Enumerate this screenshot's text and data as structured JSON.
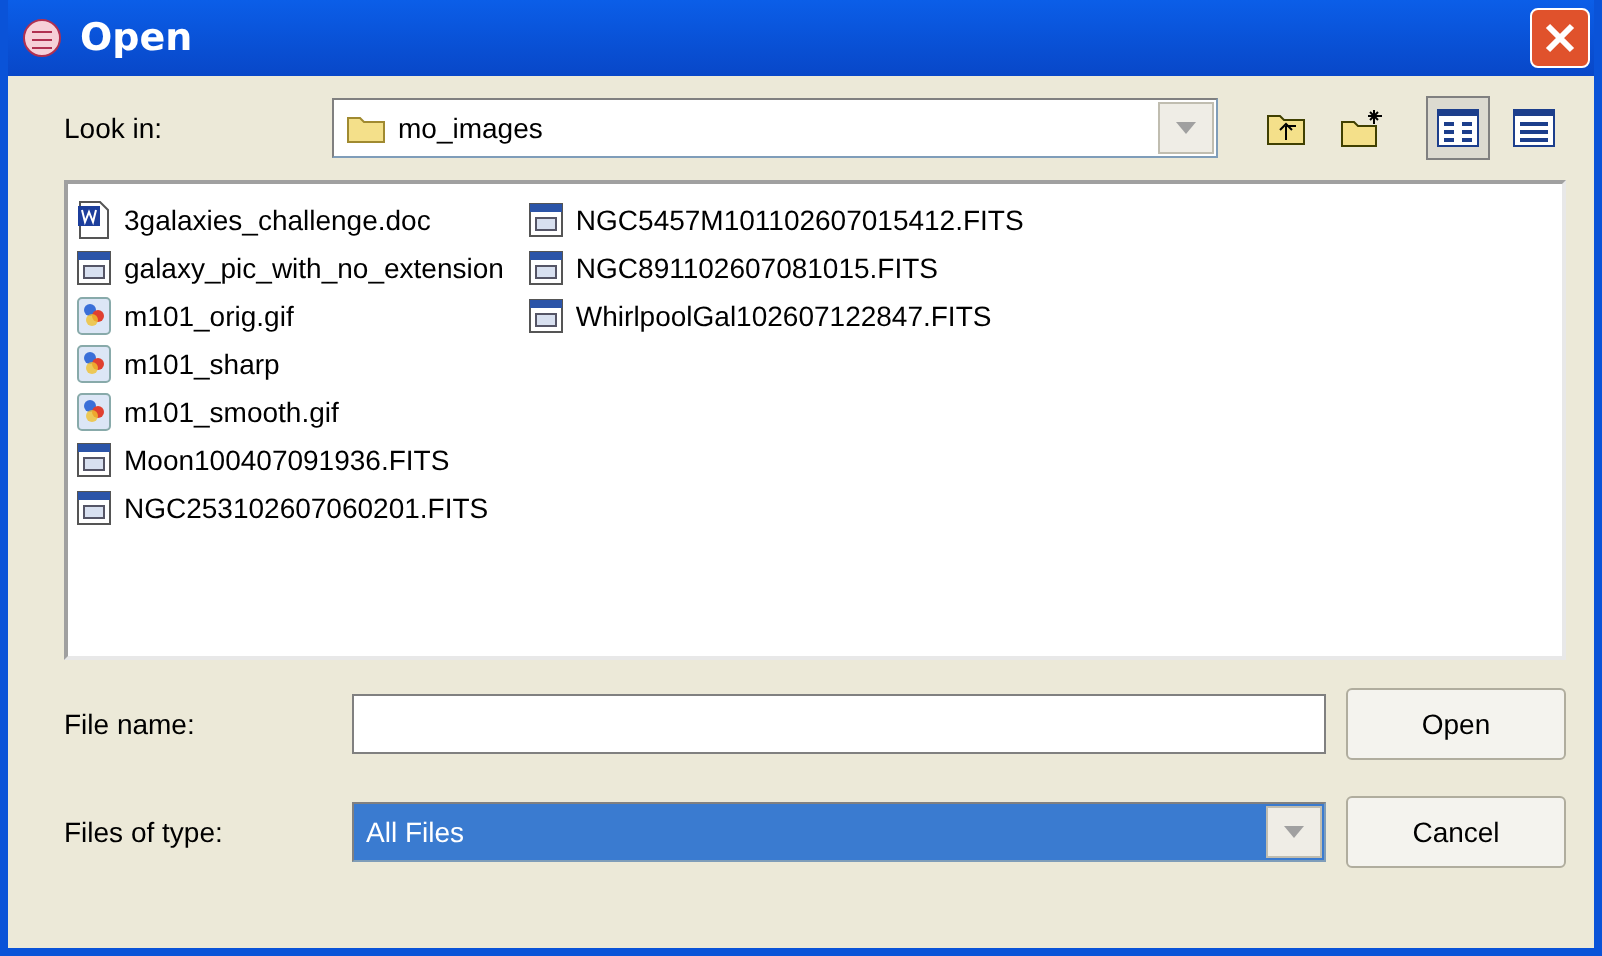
{
  "window": {
    "title": "Open"
  },
  "look_in": {
    "label": "Look in:",
    "value": "mo_images"
  },
  "toolbar": [
    {
      "kind": "up",
      "selected": false
    },
    {
      "kind": "new_folder",
      "selected": false
    },
    {
      "kind": "list",
      "selected": true
    },
    {
      "kind": "details",
      "selected": false
    }
  ],
  "files": [
    {
      "name": "3galaxies_challenge.doc",
      "kind": "doc"
    },
    {
      "name": "galaxy_pic_with_no_extension",
      "kind": "data"
    },
    {
      "name": "m101_orig.gif",
      "kind": "image"
    },
    {
      "name": "m101_sharp",
      "kind": "image"
    },
    {
      "name": "m101_smooth.gif",
      "kind": "image"
    },
    {
      "name": "Moon100407091936.FITS",
      "kind": "data"
    },
    {
      "name": "NGC253102607060201.FITS",
      "kind": "data"
    },
    {
      "name": "NGC5457M101102607015412.FITS",
      "kind": "data"
    },
    {
      "name": "NGC891102607081015.FITS",
      "kind": "data"
    },
    {
      "name": "WhirlpoolGal102607122847.FITS",
      "kind": "data"
    }
  ],
  "file_name": {
    "label": "File name:"
  },
  "file_type": {
    "label": "Files of type:",
    "value": "All Files",
    "selected": true
  },
  "buttons": [
    "Open",
    "Cancel"
  ]
}
